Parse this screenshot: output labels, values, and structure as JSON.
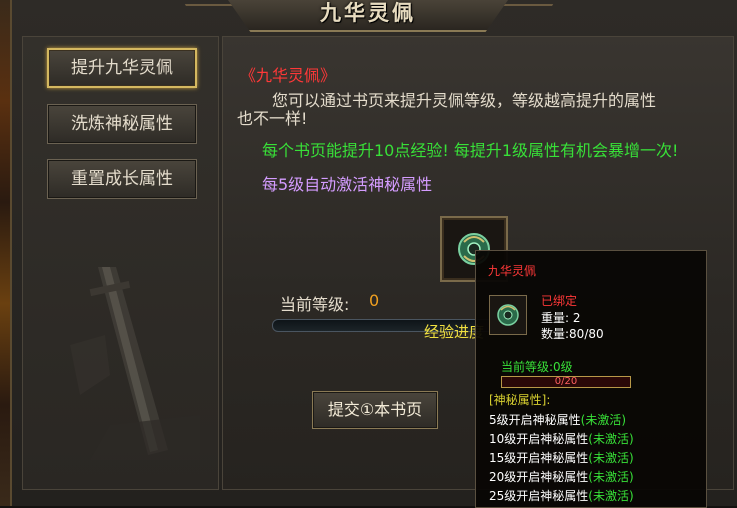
{
  "window": {
    "title": "九华灵佩"
  },
  "sidebar": {
    "items": [
      {
        "label": "提升九华灵佩",
        "active": true
      },
      {
        "label": "洗炼神秘属性",
        "active": false
      },
      {
        "label": "重置成长属性",
        "active": false
      }
    ]
  },
  "main": {
    "heading": "《九华灵佩》",
    "desc_line1": "您可以通过书页来提升灵佩等级，等级越高提升的属性",
    "desc_line2": "也不一样!",
    "tip_green": "每个书页能提升10点经验! 每提升1级属性有机会暴增一次!",
    "tip_violet": "每5级自动激活神秘属性",
    "level_label": "当前等级:",
    "level_value": "0",
    "exp_label": "经验进度",
    "exp_progress": 0,
    "submit_label": "提交①本书页"
  },
  "tooltip": {
    "name": "九华灵佩",
    "bound": "已绑定",
    "weight": "重量:  2",
    "quantity": "数量:80/80",
    "current_level": "当前等级:0级",
    "progress_text": "0/20",
    "progress": 0,
    "section_title": "[神秘属性]:",
    "attributes": [
      {
        "text": "5级开启神秘属性",
        "status": "(未激活)"
      },
      {
        "text": "10级开启神秘属性",
        "status": "(未激活)"
      },
      {
        "text": "15级开启神秘属性",
        "status": "(未激活)"
      },
      {
        "text": "20级开启神秘属性",
        "status": "(未激活)"
      },
      {
        "text": "25级开启神秘属性",
        "status": "(未激活)"
      }
    ]
  },
  "icons": {
    "item": "jade-pendant-icon"
  },
  "colors": {
    "red": "#ff3838",
    "green": "#38e038",
    "violet": "#d49cff",
    "gold": "#d4b860"
  }
}
